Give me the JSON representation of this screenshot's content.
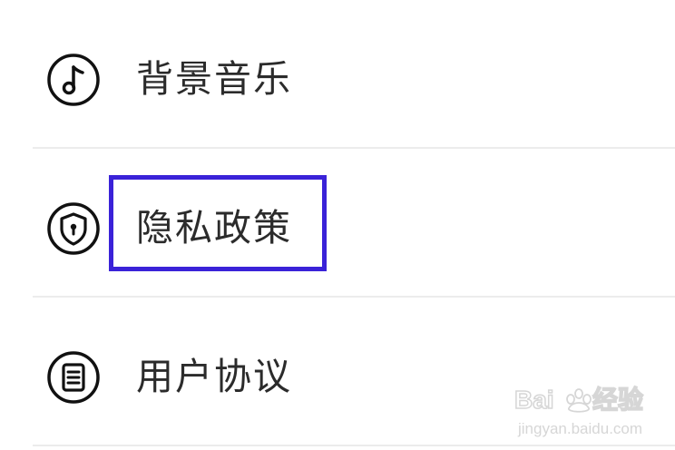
{
  "menu": {
    "items": [
      {
        "label": "背景音乐",
        "icon": "music-note-icon"
      },
      {
        "label": "隐私政策",
        "icon": "shield-lock-icon"
      },
      {
        "label": "用户协议",
        "icon": "document-icon"
      }
    ]
  },
  "highlight": {
    "target": "隐私政策",
    "color": "#3a22d8"
  },
  "watermark": {
    "brand": "Baidu经验",
    "url": "jingyan.baidu.com"
  },
  "colors": {
    "text": "#2b2b2b",
    "divider": "#ececec",
    "icon": "#111111"
  }
}
